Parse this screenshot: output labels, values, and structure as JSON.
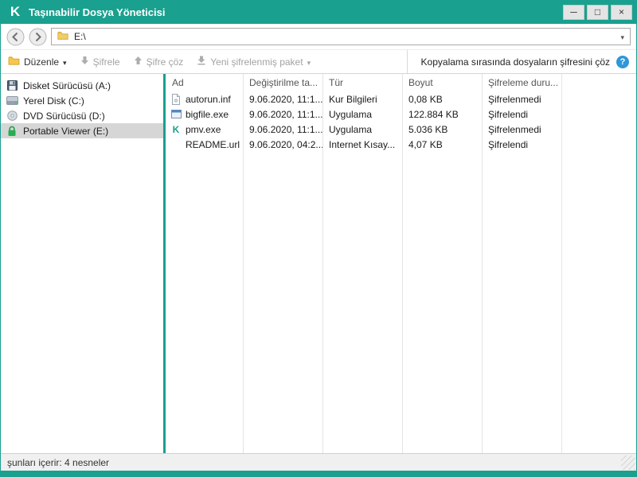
{
  "colors": {
    "accent_teal": "#1aa08f",
    "info_blue": "#2f96d8",
    "lock_green": "#27ae4f",
    "selected_item_bg": "#d6d6d6"
  },
  "window": {
    "title": "Taşınabilir Dosya Yöneticisi",
    "controls": {
      "minimize": "─",
      "maximize": "□",
      "close": "×"
    }
  },
  "navbar": {
    "address": "E:\\"
  },
  "toolbar": {
    "organize_label": "Düzenle",
    "encrypt_label": "Şifrele",
    "decrypt_label": "Şifre çöz",
    "new_package_label": "Yeni şifrelenmiş paket",
    "decrypt_on_copy_label": "Kopyalama sırasında dosyaların şifresini çöz"
  },
  "sidebar": {
    "items": [
      {
        "label": "Disket Sürücüsü (A:)",
        "icon": "floppy-icon",
        "selected": false
      },
      {
        "label": "Yerel Disk (C:)",
        "icon": "hard-disk-icon",
        "selected": false
      },
      {
        "label": "DVD Sürücüsü (D:)",
        "icon": "dvd-icon",
        "selected": false
      },
      {
        "label": "Portable Viewer (E:)",
        "icon": "lock-icon",
        "selected": true
      }
    ]
  },
  "filelist": {
    "columns": [
      "Ad",
      "Değiştirilme ta...",
      "Tür",
      "Boyut",
      "Şifreleme duru..."
    ],
    "rows": [
      {
        "icon": "setup-file-icon",
        "name": "autorun.inf",
        "date": "9.06.2020, 11:1...",
        "type": "Kur Bilgileri",
        "size": "0,08 KB",
        "status": "Şifrelenmedi"
      },
      {
        "icon": "application-icon",
        "name": "bigfile.exe",
        "date": "9.06.2020, 11:1...",
        "type": "Uygulama",
        "size": "122.884 KB",
        "status": "Şifrelendi"
      },
      {
        "icon": "kaspersky-app-icon",
        "name": "pmv.exe",
        "date": "9.06.2020, 11:1...",
        "type": "Uygulama",
        "size": "5.036 KB",
        "status": "Şifrelenmedi"
      },
      {
        "icon": "none",
        "name": "README.url",
        "date": "9.06.2020, 04:2...",
        "type": "Internet Kısay...",
        "size": "4,07 KB",
        "status": "Şifrelendi"
      }
    ]
  },
  "statusbar": {
    "text": "şunları içerir: 4 nesneler"
  }
}
